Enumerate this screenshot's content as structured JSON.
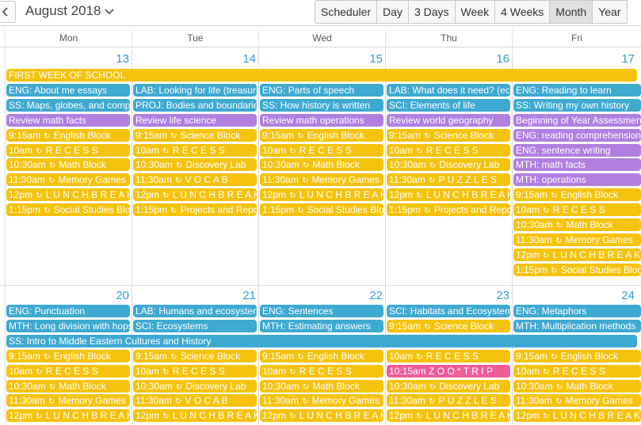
{
  "toolbar": {
    "prev_icon": "chevron-left-icon",
    "month_label": "August 2018",
    "dropdown_icon": "chevron-down-icon",
    "views": [
      "Scheduler",
      "Day",
      "3 Days",
      "Week",
      "4 Weeks",
      "Month",
      "Year"
    ],
    "active_view": "Month"
  },
  "day_headers": [
    "Mon",
    "Tue",
    "Wed",
    "Thu",
    "Fri"
  ],
  "colors": {
    "day_number": "#2f9fd0",
    "blue": "#3ea9d1",
    "yellow": "#f5c30e",
    "purple": "#b07fe0",
    "pink": "#ee5d9a"
  },
  "weeks": [
    {
      "days": [
        "13",
        "14",
        "15",
        "16",
        "17"
      ],
      "spanning": [
        {
          "text": "FIRST WEEK OF SCHOOL",
          "start": 0,
          "span": 5,
          "row": 0,
          "color": "yellow"
        }
      ],
      "cells": [
        [
          {
            "row": 1,
            "text": "ENG: About me essays",
            "color": "blue"
          },
          {
            "row": 2,
            "text": "SS: Maps, globes, and compasses",
            "color": "blue"
          },
          {
            "row": 3,
            "text": "Review math facts",
            "color": "purple"
          },
          {
            "row": 4,
            "time": "9:15am",
            "text": "English Block",
            "color": "yellow",
            "repeat": true
          },
          {
            "row": 5,
            "time": "10am",
            "text": "R E C E S S",
            "color": "yellow",
            "repeat": true
          },
          {
            "row": 6,
            "time": "10:30am",
            "text": "Math Block",
            "color": "yellow",
            "repeat": true
          },
          {
            "row": 7,
            "time": "11:30am",
            "text": "Memory Games",
            "color": "yellow",
            "repeat": true
          },
          {
            "row": 8,
            "time": "12pm",
            "text": "L U N C H B R E A K",
            "color": "yellow",
            "repeat": true
          },
          {
            "row": 9,
            "time": "1:15pm",
            "text": "Social Studies Block",
            "color": "yellow",
            "repeat": true
          }
        ],
        [
          {
            "row": 1,
            "text": "LAB: Looking for life (treasure hunt)",
            "color": "blue"
          },
          {
            "row": 2,
            "text": "PROJ: Bodies and boundaries",
            "color": "blue"
          },
          {
            "row": 3,
            "text": "Review life science",
            "color": "purple"
          },
          {
            "row": 4,
            "time": "9:15am",
            "text": "Science Block",
            "color": "yellow",
            "repeat": true
          },
          {
            "row": 5,
            "time": "10am",
            "text": "R E C E S S",
            "color": "yellow",
            "repeat": true
          },
          {
            "row": 6,
            "time": "10:30am",
            "text": "Discovery Lab",
            "color": "yellow",
            "repeat": true
          },
          {
            "row": 7,
            "time": "11:30am",
            "text": "V O C A B",
            "color": "yellow",
            "repeat": true
          },
          {
            "row": 8,
            "time": "12pm",
            "text": "L U N C H B R E A K",
            "color": "yellow",
            "repeat": true
          },
          {
            "row": 9,
            "time": "1:15pm",
            "text": "Projects and Reports",
            "color": "yellow",
            "repeat": true
          }
        ],
        [
          {
            "row": 1,
            "text": "ENG: Parts of speech",
            "color": "blue"
          },
          {
            "row": 2,
            "text": "SS: How history is written",
            "color": "blue"
          },
          {
            "row": 3,
            "text": "Review math operations",
            "color": "purple"
          },
          {
            "row": 4,
            "time": "9:15am",
            "text": "English Block",
            "color": "yellow",
            "repeat": true
          },
          {
            "row": 5,
            "time": "10am",
            "text": "R E C E S S",
            "color": "yellow",
            "repeat": true
          },
          {
            "row": 6,
            "time": "10:30am",
            "text": "Math Block",
            "color": "yellow",
            "repeat": true
          },
          {
            "row": 7,
            "time": "11:30am",
            "text": "Memory Games",
            "color": "yellow",
            "repeat": true
          },
          {
            "row": 8,
            "time": "12pm",
            "text": "L U N C H B R E A K",
            "color": "yellow",
            "repeat": true
          },
          {
            "row": 9,
            "time": "1:15pm",
            "text": "Social Studies Block",
            "color": "yellow",
            "repeat": true
          }
        ],
        [
          {
            "row": 1,
            "text": "LAB: What does it need? (ecosystems)",
            "color": "blue"
          },
          {
            "row": 2,
            "text": "SCI: Elements of life",
            "color": "blue"
          },
          {
            "row": 3,
            "text": "Review world geography",
            "color": "purple"
          },
          {
            "row": 4,
            "time": "9:15am",
            "text": "Science Block",
            "color": "yellow",
            "repeat": true
          },
          {
            "row": 5,
            "time": "10am",
            "text": "R E C E S S",
            "color": "yellow",
            "repeat": true
          },
          {
            "row": 6,
            "time": "10:30am",
            "text": "Discovery Lab",
            "color": "yellow",
            "repeat": true
          },
          {
            "row": 7,
            "time": "11:30am",
            "text": "P U Z Z L E S",
            "color": "yellow",
            "repeat": true
          },
          {
            "row": 8,
            "time": "12pm",
            "text": "L U N C H B R E A K",
            "color": "yellow",
            "repeat": true
          },
          {
            "row": 9,
            "time": "1:15pm",
            "text": "Projects and Reports",
            "color": "yellow",
            "repeat": true
          }
        ],
        [
          {
            "row": 1,
            "text": "ENG: Reading to learn",
            "color": "blue"
          },
          {
            "row": 2,
            "text": "SS: Writing my own history",
            "color": "blue"
          },
          {
            "row": 3,
            "text": "Beginning of Year Assessment",
            "color": "purple"
          },
          {
            "row": 4,
            "text": "ENG: reading comprehension",
            "color": "purple"
          },
          {
            "row": 5,
            "text": "ENG: sentence writing",
            "color": "purple"
          },
          {
            "row": 6,
            "text": "MTH: math facts",
            "color": "purple"
          },
          {
            "row": 7,
            "text": "MTH: operations",
            "color": "purple"
          },
          {
            "row": 8,
            "time": "9:15am",
            "text": "English Block",
            "color": "yellow",
            "repeat": true
          },
          {
            "row": 9,
            "time": "10am",
            "text": "R E C E S S",
            "color": "yellow",
            "repeat": true
          },
          {
            "row": 10,
            "time": "10:30am",
            "text": "Math Block",
            "color": "yellow",
            "repeat": true
          },
          {
            "row": 11,
            "time": "11:30am",
            "text": "Memory Games",
            "color": "yellow",
            "repeat": true
          },
          {
            "row": 12,
            "time": "12pm",
            "text": "L U N C H B R E A K",
            "color": "yellow",
            "repeat": true
          },
          {
            "row": 13,
            "time": "1:15pm",
            "text": "Social Studies Block",
            "color": "yellow",
            "repeat": true
          }
        ]
      ]
    },
    {
      "days": [
        "20",
        "21",
        "22",
        "23",
        "24"
      ],
      "spanning": [
        {
          "text": "SS: Intro to Middle Eastern Cultures and History",
          "start": 0,
          "span": 5,
          "row": 2,
          "color": "blue"
        }
      ],
      "cells": [
        [
          {
            "row": 0,
            "text": "ENG: Punctuation",
            "color": "blue"
          },
          {
            "row": 1,
            "text": "MTH: Long division with hops",
            "color": "blue"
          },
          {
            "row": 3,
            "time": "9:15am",
            "text": "English Block",
            "color": "yellow",
            "repeat": true
          },
          {
            "row": 4,
            "time": "10am",
            "text": "R E C E S S",
            "color": "yellow",
            "repeat": true
          },
          {
            "row": 5,
            "time": "10:30am",
            "text": "Math Block",
            "color": "yellow",
            "repeat": true
          },
          {
            "row": 6,
            "time": "11:30am",
            "text": "Memory Games",
            "color": "yellow",
            "repeat": true
          },
          {
            "row": 7,
            "time": "12pm",
            "text": "L U N C H B R E A K",
            "color": "yellow",
            "repeat": true
          }
        ],
        [
          {
            "row": 0,
            "text": "LAB: Humans and ecosystems",
            "color": "blue"
          },
          {
            "row": 1,
            "text": "SCI: Ecosystems",
            "color": "blue"
          },
          {
            "row": 3,
            "time": "9:15am",
            "text": "Science Block",
            "color": "yellow",
            "repeat": true
          },
          {
            "row": 4,
            "time": "10am",
            "text": "R E C E S S",
            "color": "yellow",
            "repeat": true
          },
          {
            "row": 5,
            "time": "10:30am",
            "text": "Discovery Lab",
            "color": "yellow",
            "repeat": true
          },
          {
            "row": 6,
            "time": "11:30am",
            "text": "V O C A B",
            "color": "yellow",
            "repeat": true
          },
          {
            "row": 7,
            "time": "12pm",
            "text": "L U N C H B R E A K",
            "color": "yellow",
            "repeat": true
          }
        ],
        [
          {
            "row": 0,
            "text": "ENG: Sentences",
            "color": "blue"
          },
          {
            "row": 1,
            "text": "MTH: Estimating answers",
            "color": "blue"
          },
          {
            "row": 3,
            "time": "9:15am",
            "text": "English Block",
            "color": "yellow",
            "repeat": true
          },
          {
            "row": 4,
            "time": "10am",
            "text": "R E C E S S",
            "color": "yellow",
            "repeat": true
          },
          {
            "row": 5,
            "time": "10:30am",
            "text": "Math Block",
            "color": "yellow",
            "repeat": true
          },
          {
            "row": 6,
            "time": "11:30am",
            "text": "Memory Games",
            "color": "yellow",
            "repeat": true
          },
          {
            "row": 7,
            "time": "12pm",
            "text": "L U N C H B R E A K",
            "color": "yellow",
            "repeat": true
          }
        ],
        [
          {
            "row": 0,
            "text": "SCI: Habitats and Ecosystems",
            "color": "blue"
          },
          {
            "row": 1,
            "time": "9:15am",
            "text": "Science Block",
            "color": "yellow",
            "repeat": true
          },
          {
            "row": 3,
            "time": "10am",
            "text": "R E C E S S",
            "color": "yellow",
            "repeat": true
          },
          {
            "row": 4,
            "time": "10:15am",
            "text": "Z O O * T R I P",
            "color": "pink",
            "repeat": false
          },
          {
            "row": 5,
            "time": "10:30am",
            "text": "Discovery Lab",
            "color": "yellow",
            "repeat": true
          },
          {
            "row": 6,
            "time": "11:30am",
            "text": "P U Z Z L E S",
            "color": "yellow",
            "repeat": true
          },
          {
            "row": 7,
            "time": "12pm",
            "text": "L U N C H B R E A K",
            "color": "yellow",
            "repeat": true
          }
        ],
        [
          {
            "row": 0,
            "text": "ENG: Metaphors",
            "color": "blue"
          },
          {
            "row": 1,
            "text": "MTH: Multiplication methods",
            "color": "blue"
          },
          {
            "row": 3,
            "time": "9:15am",
            "text": "English Block",
            "color": "yellow",
            "repeat": true
          },
          {
            "row": 4,
            "time": "10am",
            "text": "R E C E S S",
            "color": "yellow",
            "repeat": true
          },
          {
            "row": 5,
            "time": "10:30am",
            "text": "Math Block",
            "color": "yellow",
            "repeat": true
          },
          {
            "row": 6,
            "time": "11:30am",
            "text": "Memory Games",
            "color": "yellow",
            "repeat": true
          },
          {
            "row": 7,
            "time": "12pm",
            "text": "L U N C H B R E A K",
            "color": "yellow",
            "repeat": true
          }
        ]
      ]
    }
  ]
}
